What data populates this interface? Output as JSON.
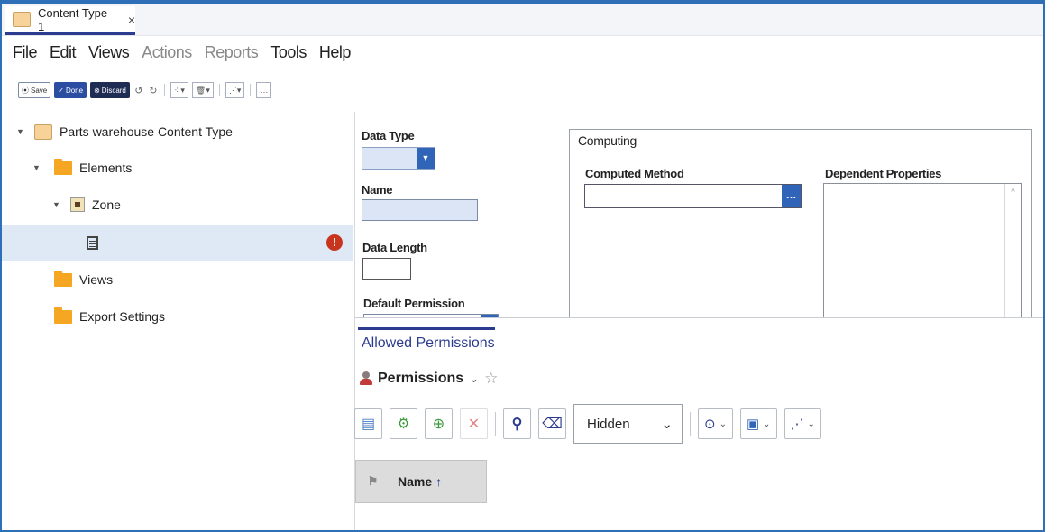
{
  "tab": {
    "title": "Content Type 1",
    "close_glyph": "×"
  },
  "menu": [
    "File",
    "Edit",
    "Views",
    "Actions",
    "Reports",
    "Tools",
    "Help"
  ],
  "menu_disabled": [
    "Actions",
    "Reports"
  ],
  "toolbar": {
    "save": "Save",
    "done": "Done",
    "discard": "Discard",
    "more": "…"
  },
  "tree": {
    "root": "Parts warehouse Content Type",
    "elements": "Elements",
    "zone": "Zone",
    "views": "Views",
    "export": "Export Settings",
    "error_glyph": "!"
  },
  "form": {
    "data_type_label": "Data Type",
    "name_label": "Name",
    "data_length_label": "Data Length",
    "default_permission_label": "Default Permission",
    "computing_title": "Computing",
    "computed_method_label": "Computed Method",
    "dependent_properties_label": "Dependent Properties",
    "dots": "…"
  },
  "permissions": {
    "tab_label": "Allowed Permissions",
    "title": "Permissions",
    "view_select": "Hidden",
    "column_name": "Name",
    "sort_glyph": "↑"
  },
  "colors": {
    "accent": "#2f64b8",
    "folder": "#f5a623",
    "error": "#c8351e",
    "tab_underline": "#2b3b8f",
    "selection": "#dfe8f5"
  }
}
